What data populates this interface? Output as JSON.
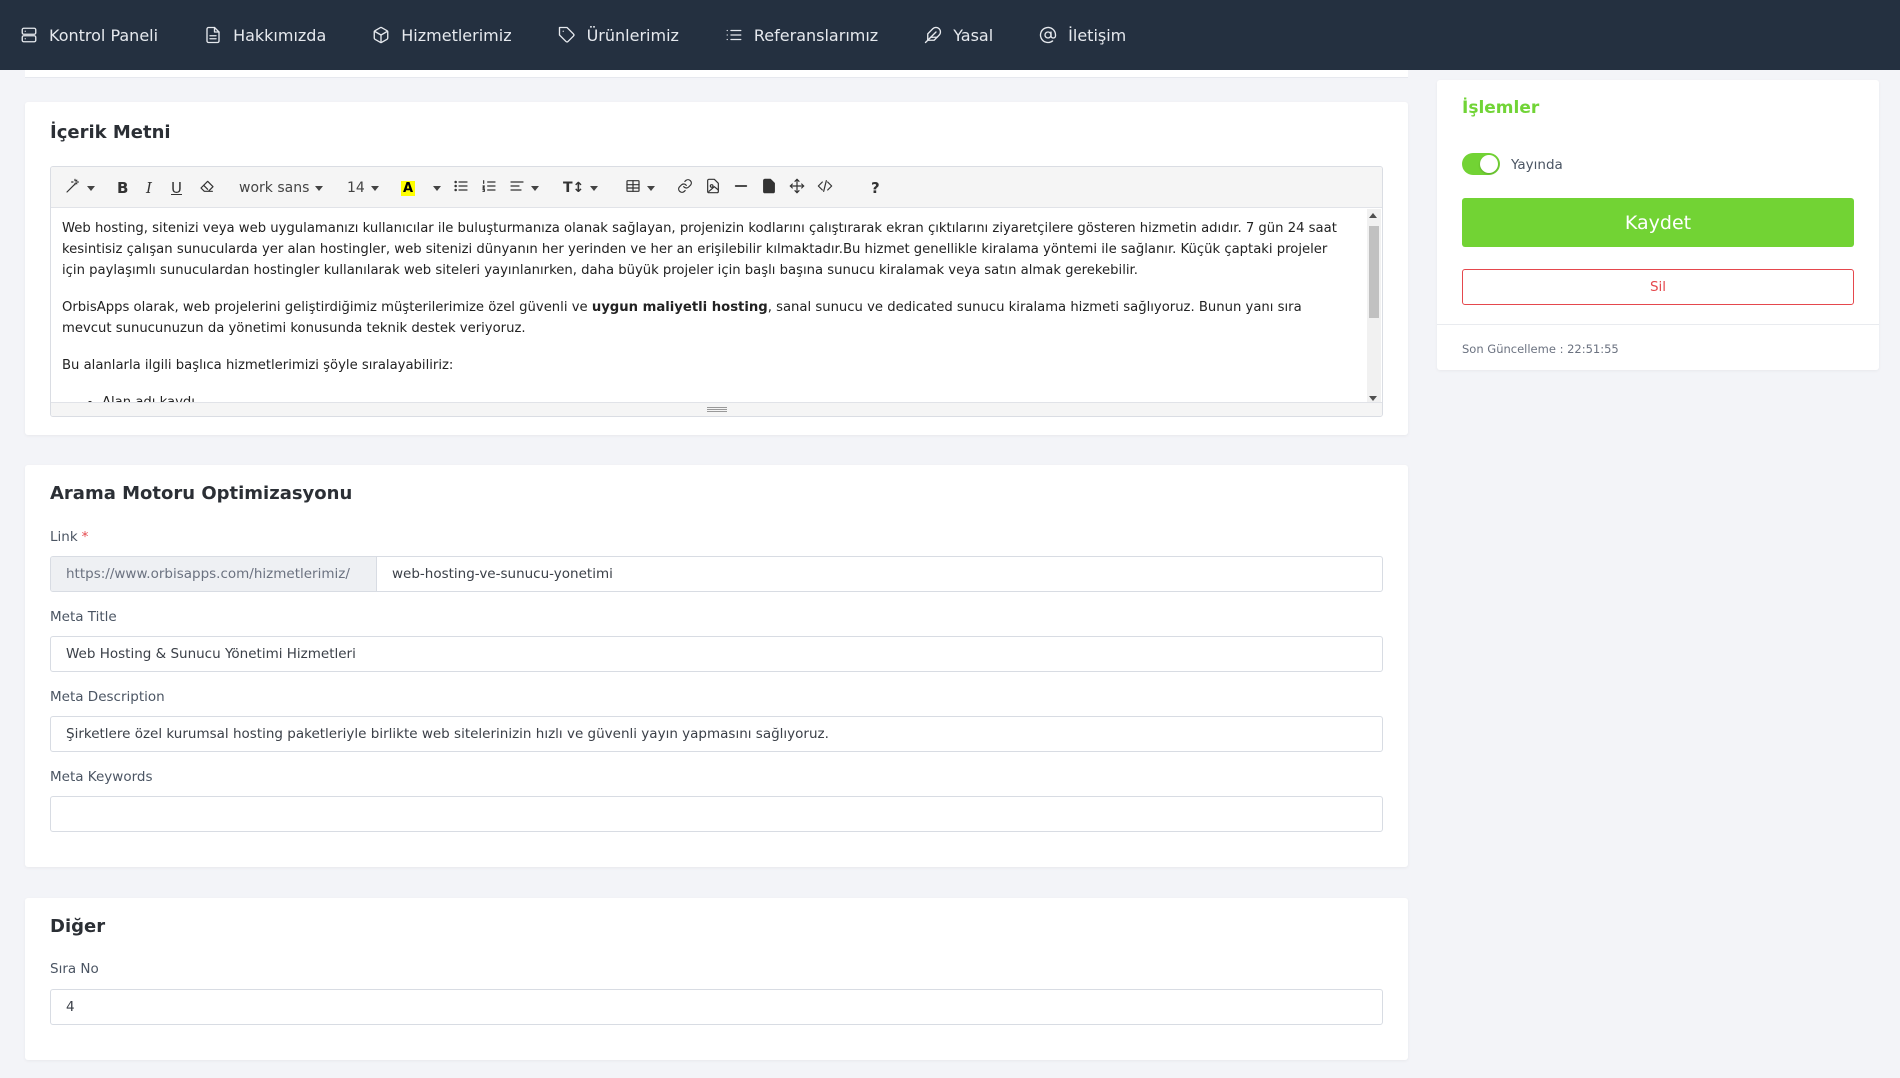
{
  "nav": {
    "items": [
      {
        "label": "Kontrol Paneli",
        "icon": "server-icon"
      },
      {
        "label": "Hakkımızda",
        "icon": "file-text-icon"
      },
      {
        "label": "Hizmetlerimiz",
        "icon": "box-icon"
      },
      {
        "label": "Ürünlerimiz",
        "icon": "tag-icon"
      },
      {
        "label": "Referanslarımız",
        "icon": "list-icon"
      },
      {
        "label": "Yasal",
        "icon": "feather-icon"
      },
      {
        "label": "İletişim",
        "icon": "at-sign-icon"
      }
    ]
  },
  "content": {
    "title": "İçerik Metni",
    "toolbar": {
      "font_family": "work sans",
      "font_size": "14",
      "help": "?"
    },
    "paragraph1": "Web hosting, sitenizi veya web uygulamanızı kullanıcılar ile buluşturmanıza olanak sağlayan, projenizin kodlarını çalıştırarak ekran çıktılarını ziyaretçilere gösteren hizmetin adıdır. 7 gün 24 saat kesintisiz çalışan sunucularda yer alan hostingler, web sitenizi dünyanın her yerinden ve her an erişilebilir kılmaktadır.Bu hizmet genellikle kiralama yöntemi ile sağlanır. Küçük çaptaki projeler için paylaşımlı sunuculardan hostingler kullanılarak web siteleri yayınlanırken, daha büyük projeler için başlı başına sunucu kiralamak veya satın almak gerekebilir.",
    "paragraph2_before": "OrbisApps olarak, web projelerini geliştirdiğimiz müşterilerimize özel güvenli ve ",
    "paragraph2_bold": "uygun maliyetli hosting",
    "paragraph2_after": ", sanal sunucu ve dedicated sunucu kiralama hizmeti sağlıyoruz. Bunun yanı sıra mevcut sunucunuzun da yönetimi konusunda teknik destek veriyoruz.",
    "paragraph3": "Bu alanlarla ilgili başlıca hizmetlerimizi şöyle sıralayabiliriz:",
    "list": [
      "Alan adı kaydı"
    ]
  },
  "seo": {
    "title": "Arama Motoru Optimizasyonu",
    "link_label": "Link",
    "required_mark": "*",
    "link_prefix": "https://www.orbisapps.com/hizmetlerimiz/",
    "link_value": "web-hosting-ve-sunucu-yonetimi",
    "meta_title_label": "Meta Title",
    "meta_title_value": "Web Hosting & Sunucu Yönetimi Hizmetleri",
    "meta_description_label": "Meta Description",
    "meta_description_value": "Şirketlere özel kurumsal hosting paketleriyle birlikte web sitelerinizin hızlı ve güvenli yayın yapmasını sağlıyoruz.",
    "meta_keywords_label": "Meta Keywords",
    "meta_keywords_value": ""
  },
  "other": {
    "title": "Diğer",
    "order_label": "Sıra No",
    "order_value": "4"
  },
  "actions": {
    "title": "İşlemler",
    "publish_label": "Yayında",
    "published": true,
    "save_label": "Kaydet",
    "delete_label": "Sil",
    "last_update": "Son Güncelleme : 22:51:55"
  },
  "colors": {
    "navbar": "#243040",
    "accent_green": "#72d334",
    "danger": "#e5484d"
  }
}
